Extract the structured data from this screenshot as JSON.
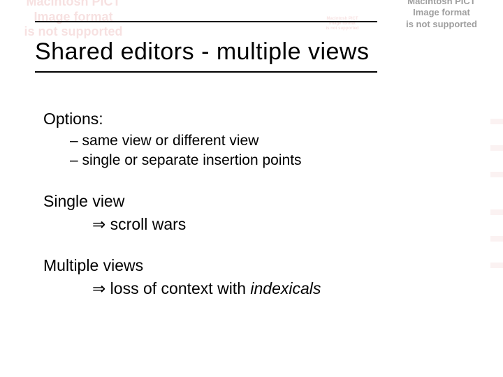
{
  "title": "Shared editors - multiple views",
  "options": {
    "lead": "Options:",
    "items": [
      "– same view or different view",
      "– single or separate insertion points"
    ]
  },
  "single_view": {
    "lead": "Single view",
    "arrow": "⇒",
    "result": "scroll wars"
  },
  "multiple_views": {
    "lead": "Multiple views",
    "arrow": "⇒",
    "result_prefix": "loss of context with ",
    "result_em": "indexicals"
  },
  "pict_msg": {
    "l1": "Macintosh PICT",
    "l2": "Image format",
    "l3": "is not supported"
  }
}
